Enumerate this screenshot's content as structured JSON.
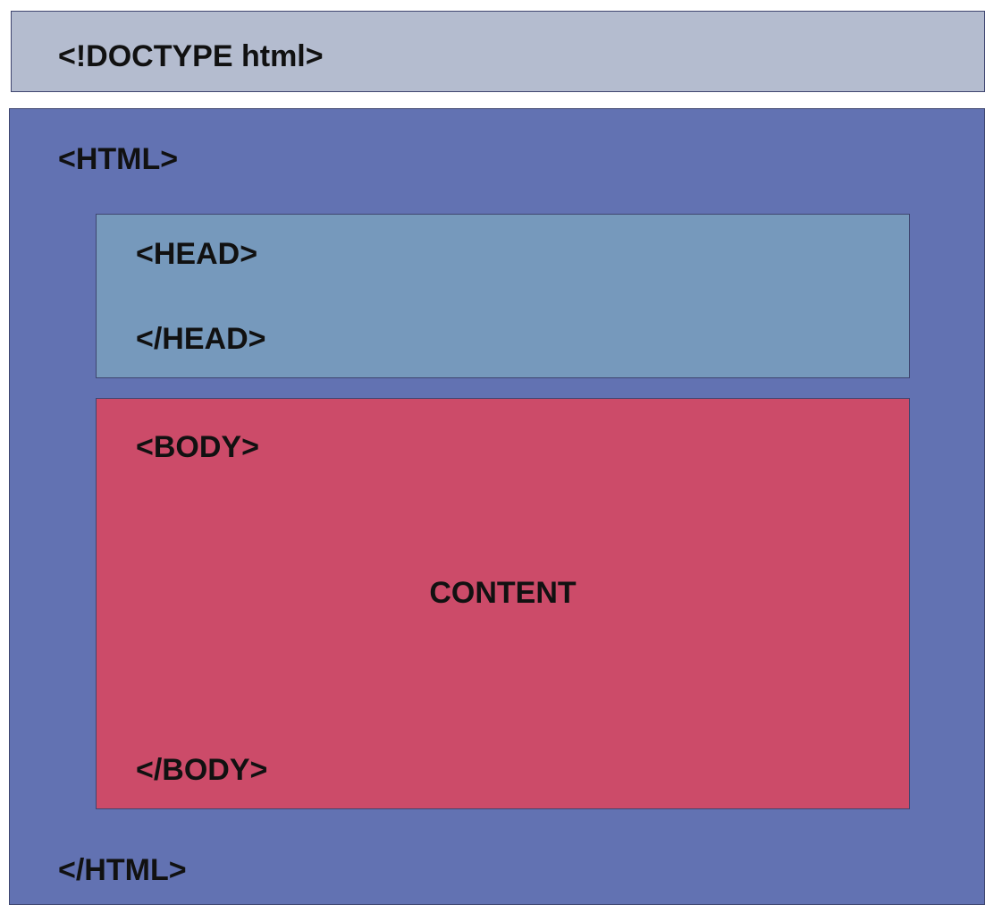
{
  "colors": {
    "doctype": "#b4bccf",
    "html": "#6272b2",
    "head": "#7699bc",
    "body": "#cc4b69",
    "border": "#3f4670",
    "text": "#111111"
  },
  "doctype": {
    "label": "<!DOCTYPE html>"
  },
  "html": {
    "open": "<HTML>",
    "close": "</HTML>"
  },
  "head": {
    "open": "<HEAD>",
    "close": "</HEAD>"
  },
  "body": {
    "open": "<BODY>",
    "content": "CONTENT",
    "close": "</BODY>"
  }
}
